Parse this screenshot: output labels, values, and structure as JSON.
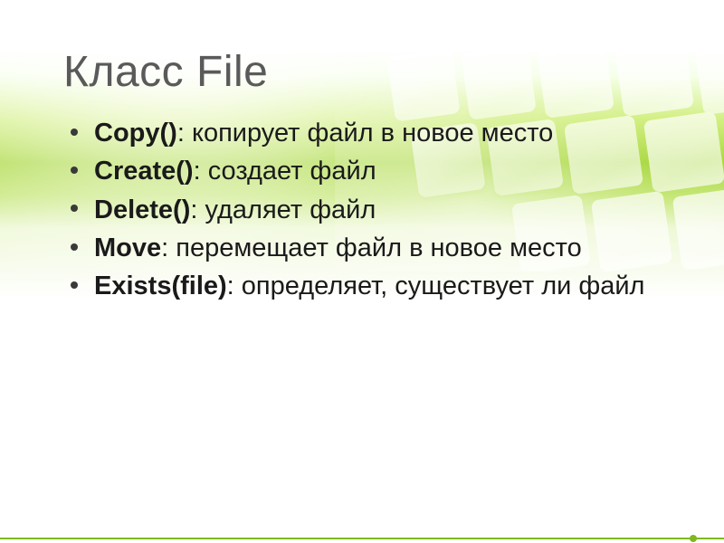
{
  "title": "Класс File",
  "bullets": [
    {
      "method": "Copy()",
      "desc": ": копирует файл в новое место"
    },
    {
      "method": "Create()",
      "desc": ": создает файл"
    },
    {
      "method": "Delete()",
      "desc": ": удаляет файл"
    },
    {
      "method": "Move",
      "desc": ": перемещает файл в новое место"
    },
    {
      "method": "Exists(file)",
      "desc": ": определяет, существует ли файл"
    }
  ]
}
